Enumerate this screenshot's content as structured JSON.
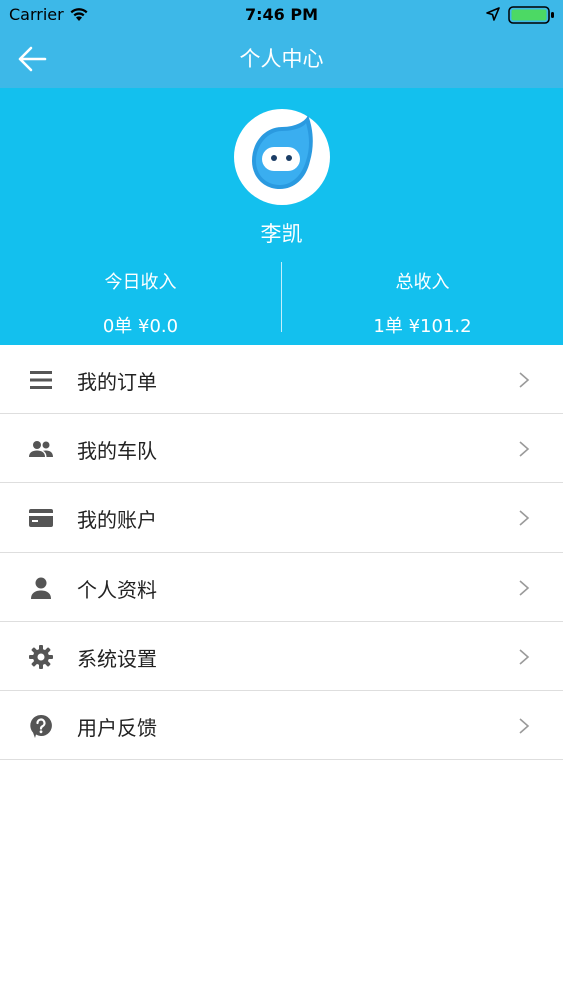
{
  "status_bar": {
    "carrier": "Carrier",
    "time": "7:46 PM"
  },
  "nav": {
    "title": "个人中心"
  },
  "profile": {
    "name": "李凯"
  },
  "stats": {
    "today": {
      "label": "今日收入",
      "value": "0单 ¥0.0"
    },
    "total": {
      "label": "总收入",
      "value": "1单 ¥101.2"
    }
  },
  "menu": {
    "items": [
      {
        "label": "我的订单",
        "icon": "list-icon"
      },
      {
        "label": "我的车队",
        "icon": "group-icon"
      },
      {
        "label": "我的账户",
        "icon": "card-icon"
      },
      {
        "label": "个人资料",
        "icon": "person-icon"
      },
      {
        "label": "系统设置",
        "icon": "gear-icon"
      },
      {
        "label": "用户反馈",
        "icon": "help-icon"
      }
    ]
  },
  "colors": {
    "nav_blue": "#3db8e8",
    "header_blue": "#13c0ee",
    "icon_gray": "#555555",
    "chevron_gray": "#9a9a9a",
    "battery_green": "#4cd964"
  }
}
